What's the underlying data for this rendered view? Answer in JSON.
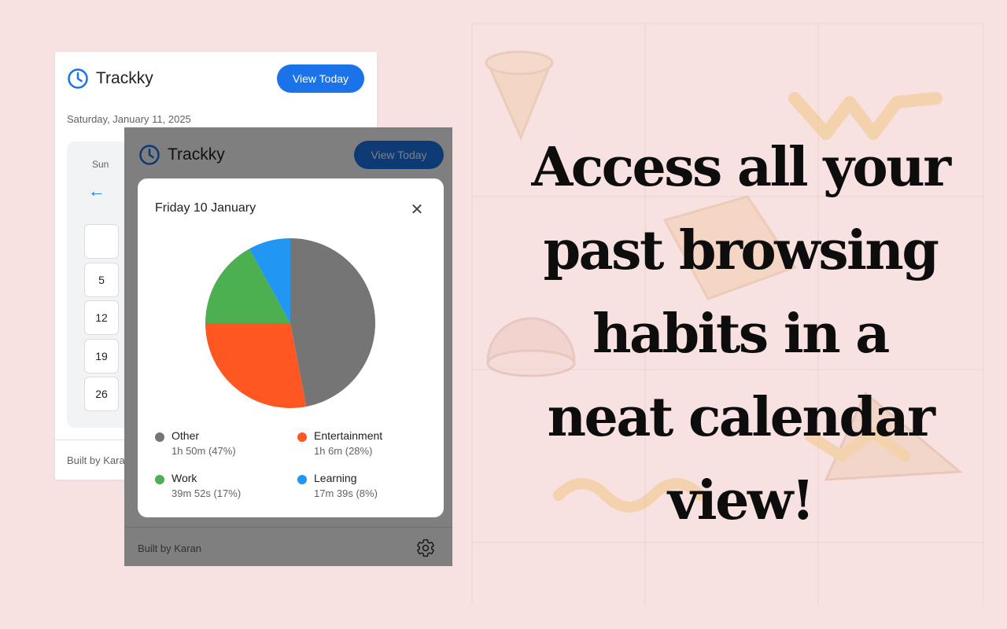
{
  "colors": {
    "background": "#f7e1e1",
    "accent": "#1a73e8",
    "pie": [
      "#757575",
      "#ff5722",
      "#4caf50",
      "#2196f3"
    ]
  },
  "back_card": {
    "brand": "Trackky",
    "view_today": "View Today",
    "date": "Saturday, January 11, 2025",
    "calendar": {
      "weekday": "Sun",
      "prev_arrow": "←",
      "days": [
        "",
        "5",
        "12",
        "19",
        "26"
      ]
    },
    "footer": "Built by Karan"
  },
  "front_card": {
    "brand": "Trackky",
    "view_today": "View Today",
    "footer": "Built by Karan"
  },
  "modal": {
    "title": "Friday 10 January",
    "close": "✕"
  },
  "chart_data": {
    "type": "pie",
    "title": "Friday 10 January",
    "legend_placement": "bottom",
    "slices": [
      {
        "label": "Other",
        "duration": "1h 50m",
        "percent": 47,
        "value_text": "1h 50m (47%)",
        "color": "#757575"
      },
      {
        "label": "Entertainment",
        "duration": "1h 6m",
        "percent": 28,
        "value_text": "1h 6m (28%)",
        "color": "#ff5722"
      },
      {
        "label": "Work",
        "duration": "39m 52s",
        "percent": 17,
        "value_text": "39m 52s (17%)",
        "color": "#4caf50"
      },
      {
        "label": "Learning",
        "duration": "17m 39s",
        "percent": 8,
        "value_text": "17m 39s (8%)",
        "color": "#2196f3"
      }
    ]
  },
  "headline": {
    "lines": [
      "Access all your",
      "past browsing",
      "habits in a",
      "neat calendar",
      "view!"
    ]
  }
}
